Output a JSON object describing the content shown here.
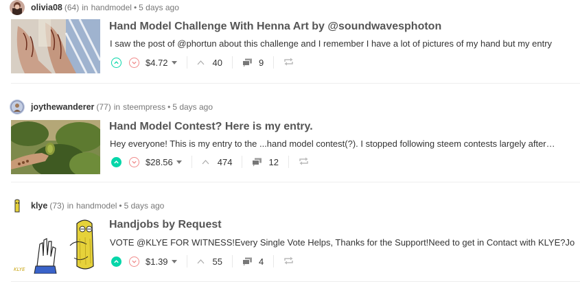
{
  "posts": [
    {
      "author": "olivia08",
      "reputation": "(64)",
      "in_text": "in",
      "category": "handmodel",
      "separator": "•",
      "time": "5 days ago",
      "title": "Hand Model Challenge With Henna Art by @soundwavesphoton",
      "body": "I saw the post of @phortun about this challenge and I remember I have a lot of pictures of my hand but my entry",
      "payout": "$4.72",
      "votes": "40",
      "comments": "9",
      "upvoted": false
    },
    {
      "author": "joythewanderer",
      "reputation": "(77)",
      "in_text": "in",
      "category": "steempress",
      "separator": "•",
      "time": "5 days ago",
      "title": "Hand Model Contest? Here is my entry.",
      "body": "Hey everyone! This is my entry to the ...hand model contest(?). I stopped following steem contests largely after…",
      "payout": "$28.56",
      "votes": "474",
      "comments": "12",
      "upvoted": true
    },
    {
      "author": "klye",
      "reputation": "(73)",
      "in_text": "in",
      "category": "handmodel",
      "separator": "•",
      "time": "5 days ago",
      "title": "Handjobs by Request",
      "body": "VOTE @KLYE FOR WITNESS!Every Single Vote Helps, Thanks for the Support!Need to get in Contact with KLYE?Jo",
      "payout": "$1.39",
      "votes": "55",
      "comments": "4",
      "upvoted": true,
      "thumb_signature": "KLYE"
    }
  ],
  "colors": {
    "upvote": "#06d6a9",
    "downvote": "#f08a8a",
    "muted": "#777777",
    "title": "#555555"
  },
  "icons": {
    "upvote": "chevron-up-circle-icon",
    "downvote": "chevron-down-circle-icon",
    "votes": "chevron-up-icon",
    "comments": "comments-icon",
    "reblog": "reblog-icon"
  }
}
